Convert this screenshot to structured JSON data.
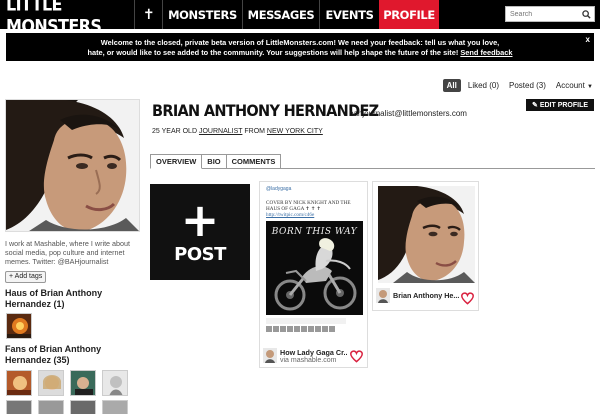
{
  "nav": {
    "logo": "LITTLE MONSTERS",
    "cross": "✝",
    "items": [
      "MONSTERS",
      "MESSAGES",
      "EVENTS",
      "PROFILE"
    ],
    "search_placeholder": "Search"
  },
  "banner": {
    "line1": "Welcome to the closed, private beta version of LittleMonsters.com! We need your feedback: tell us what you love,",
    "line2": "hate, or would like to see added to the community. Your suggestions will help shape the future of the site!",
    "link": "Send feedback",
    "close": "x"
  },
  "filters": {
    "all": "All",
    "liked": "Liked (0)",
    "posted": "Posted (3)",
    "account": "Account"
  },
  "profile": {
    "name": "BRIAN ANTHONY HERNANDEZ",
    "email": "bahjournalist@littlemonsters.com",
    "edit_label": "EDIT PROFILE",
    "age_text": "25 YEAR OLD",
    "occupation": "JOURNALIST",
    "from_text": "FROM",
    "location": "NEW YORK CITY",
    "bio": "I work at Mashable, where I write about social media, pop culture and internet memes. Twitter: @BAHjournalist",
    "add_tags": "+ Add tags"
  },
  "sidebar": {
    "haus_heading": "Haus of Brian Anthony Hernandez (1)",
    "fans_heading": "Fans of Brian Anthony Hernandez (35)"
  },
  "tabs": [
    "OVERVIEW",
    "BIO",
    "COMMENTS"
  ],
  "post_tile": {
    "plus": "+",
    "label": "POST"
  },
  "cards": {
    "gaga": {
      "handle": "@ladygaga",
      "tweet": "COVER BY NICK KNIGHT AND THE HAUS OF GAGA ✝ ✝ ✝",
      "tweet_link": "http://twitpic.com/c46e",
      "album_title": "BORN THIS WAY",
      "caption": "How Lady Gaga Cr...",
      "source": "via mashable.com"
    },
    "brian": {
      "caption": "Brian Anthony He..."
    }
  },
  "colors": {
    "nav_bg": "#000000",
    "profile_active": "#e0182d",
    "heart": "#d9213f"
  }
}
